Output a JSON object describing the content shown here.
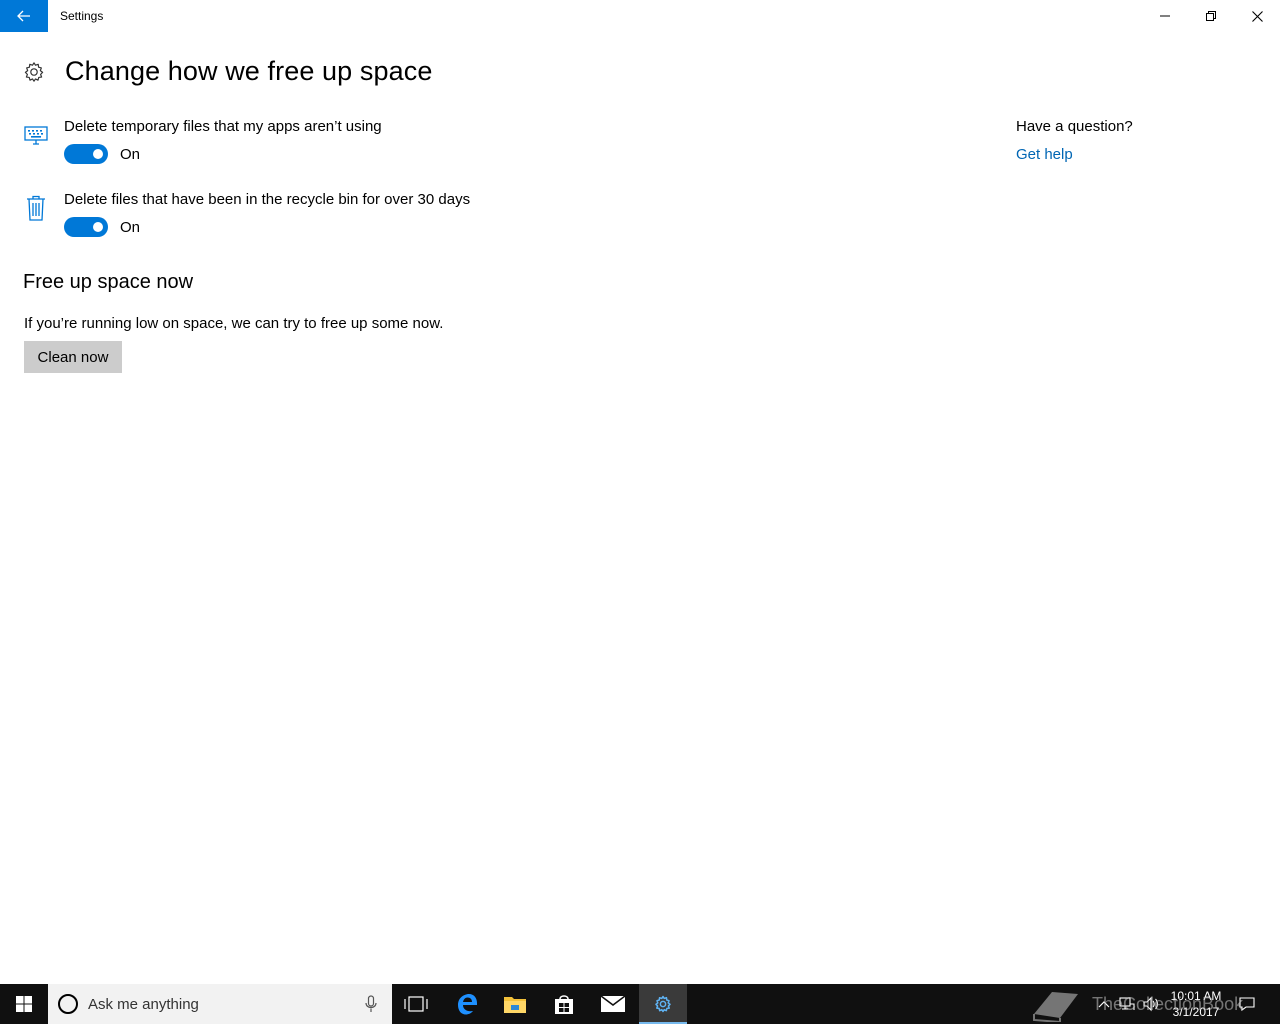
{
  "window": {
    "title": "Settings"
  },
  "header": {
    "title": "Change how we free up space"
  },
  "settings": [
    {
      "label": "Delete temporary files that my apps aren’t using",
      "state": "On",
      "enabled": true,
      "icon": "keyboard-icon"
    },
    {
      "label": "Delete files that have been in the recycle bin for over 30 days",
      "state": "On",
      "enabled": true,
      "icon": "recycle-bin-icon"
    }
  ],
  "free_up": {
    "title": "Free up space now",
    "description": "If you’re running low on space, we can try to free up some now.",
    "button_label": "Clean now"
  },
  "help": {
    "question": "Have a question?",
    "link": "Get help"
  },
  "taskbar": {
    "search_placeholder": "Ask me anything",
    "clock_time": "10:01 AM",
    "clock_date": "3/1/2017"
  },
  "watermark": {
    "text": "TheCollectionBook"
  },
  "colors": {
    "accent": "#0078d7",
    "link": "#0066b4",
    "taskbar": "#101010"
  }
}
